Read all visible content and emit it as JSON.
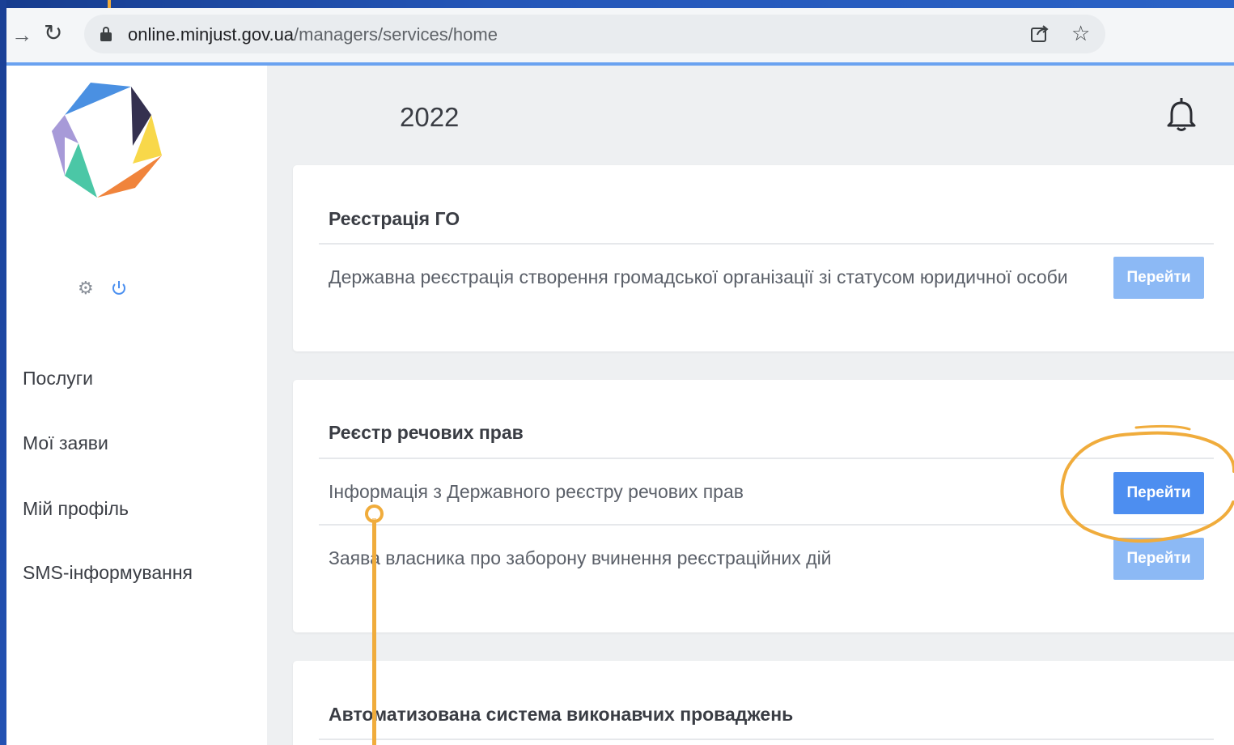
{
  "browser": {
    "url_host": "online.minjust.gov.ua",
    "url_path": "/managers/services/home",
    "forward_glyph": "→",
    "reload_glyph": "↻",
    "star_glyph": "☆"
  },
  "sidebar": {
    "gear_glyph": "⚙",
    "menu": [
      {
        "label": "Послуги"
      },
      {
        "label": "Мої заяви"
      },
      {
        "label": "Мій профіль"
      },
      {
        "label": "SMS-інформування"
      }
    ]
  },
  "header": {
    "year": "2022"
  },
  "cards": [
    {
      "title": "Реєстрація ГО",
      "services": [
        {
          "text": "Державна реєстрація створення громадської організації зі статусом юридичної особи",
          "button": "Перейти"
        }
      ]
    },
    {
      "title": "Реєстр речових прав",
      "services": [
        {
          "text": "Інформація з Державного реєстру речових прав",
          "button": "Перейти"
        },
        {
          "text": "Заява власника про заборону вчинення реєстраційних дій",
          "button": "Перейти"
        }
      ]
    },
    {
      "title": "Автоматизована система виконавчих проваджень",
      "services": []
    }
  ],
  "colors": {
    "frame_blue": "#1d4aa8",
    "button_light": "#8cb9f5",
    "button_active": "#4d8ef0",
    "annotation_orange": "#f0ac3c",
    "main_bg": "#eef0f2"
  },
  "icons": [
    "forward-icon",
    "reload-icon",
    "lock-icon",
    "share-icon",
    "star-icon",
    "gear-icon",
    "power-icon",
    "bell-icon",
    "logo"
  ]
}
